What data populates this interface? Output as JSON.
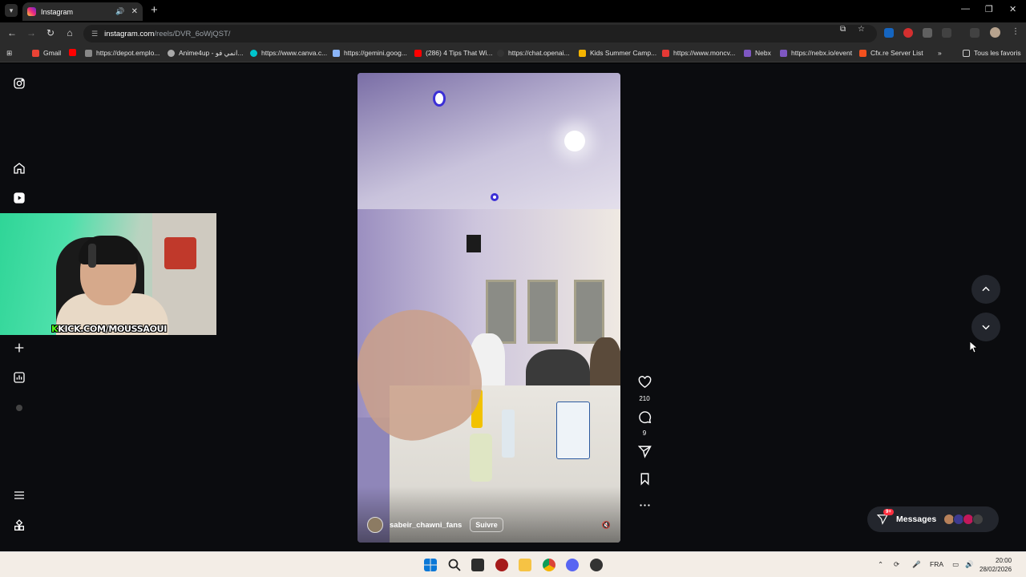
{
  "browser": {
    "tab": {
      "title": "Instagram"
    },
    "address": {
      "host": "instagram.com",
      "path": "/reels/DVR_6oWjQST/"
    },
    "bookmarks": [
      {
        "label": "Gmail",
        "color": "#ea4335"
      },
      {
        "label": "",
        "color": "#ff0000"
      },
      {
        "label": "https://depot.emplo...",
        "color": "#888888"
      },
      {
        "label": "Anime4up - انمي فو...",
        "color": "#aaaaaa"
      },
      {
        "label": "https://www.canva.c...",
        "color": "#00c4cc"
      },
      {
        "label": "https://gemini.goog...",
        "color": "#8ab4f8"
      },
      {
        "label": "(286) 4 Tips That Wi...",
        "color": "#ff0000"
      },
      {
        "label": "https://chat.openai...",
        "color": "#333333"
      },
      {
        "label": "Kids Summer Camp...",
        "color": "#f4b400"
      },
      {
        "label": "https://www.moncv...",
        "color": "#e53935"
      },
      {
        "label": "Nebx",
        "color": "#7e57c2"
      },
      {
        "label": "https://nebx.io/event",
        "color": "#7e57c2"
      },
      {
        "label": "Cfx.re Server List",
        "color": "#f4511e"
      }
    ],
    "bookmarks_more": "»",
    "all_bookmarks": "Tous les favoris"
  },
  "webcam": {
    "caption_k": "K",
    "caption_rest": "KICK.COM/MOUSSAOUI"
  },
  "reel": {
    "author": "sabeir_chawni_fans",
    "follow_label": "Suivre",
    "likes": "210",
    "comments": "9"
  },
  "messages": {
    "label": "Messages",
    "badge": "9+"
  },
  "taskbar": {
    "language": "FRA",
    "time": "20:00",
    "date": "28/02/2026"
  },
  "colors": {
    "accent_red": "#ff3040",
    "page_bg": "#0b0c0f",
    "kick_green": "#53fc18"
  }
}
